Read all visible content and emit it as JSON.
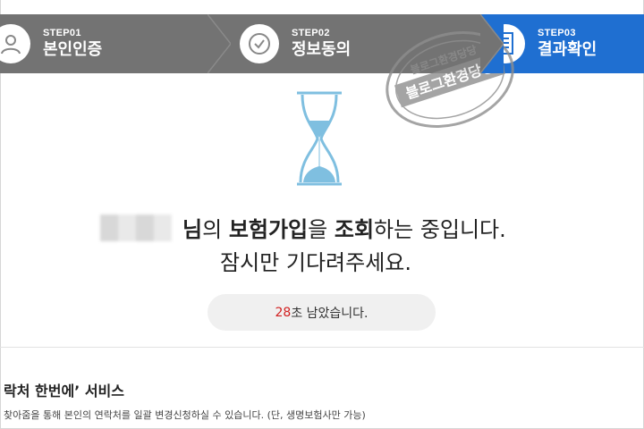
{
  "steps": [
    {
      "no": "STEP01",
      "label": "본인인증",
      "icon": "person-icon"
    },
    {
      "no": "STEP02",
      "label": "정보동의",
      "icon": "check-circle-icon"
    },
    {
      "no": "STEP03",
      "label": "결과확인",
      "icon": "document-icon"
    }
  ],
  "colors": {
    "stepper_bg": "#737373",
    "active_step": "#1f6fd1",
    "countdown_number": "#d11f1f",
    "hourglass": "#7fbfe0"
  },
  "message": {
    "suffix_1": "님",
    "part_2": "의 ",
    "bold_3": "보험가입",
    "part_4": "을 ",
    "bold_5": "조회",
    "part_6": "하는 중입니다.",
    "line_2": "잠시만 기다려주세요."
  },
  "countdown": {
    "seconds": "28",
    "text": "초 남았습니다."
  },
  "service": {
    "title": "락처 한번에’ 서비스",
    "description": "찾아줌을 통해 본인의 연락처를 일괄 변경신청하실 수 있습니다. (단, 생명보험사만 가능)"
  },
  "stamp": {
    "text_top": "블로그환경당당",
    "text_mid": "블로그환경당당"
  }
}
